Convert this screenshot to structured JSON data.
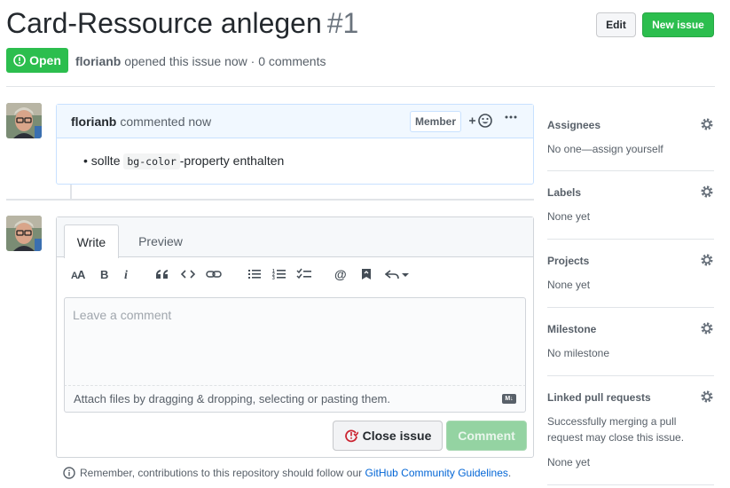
{
  "issue": {
    "title": "Card-Ressource anlegen",
    "number": "#1",
    "state": "Open",
    "author": "florianb",
    "meta_rest": "opened this issue now · 0 comments",
    "edit_label": "Edit",
    "new_issue_label": "New issue"
  },
  "comment": {
    "author": "florianb",
    "time": "commented now",
    "badge": "Member",
    "body_pre": "sollte",
    "body_code": "bg-color",
    "body_post": "-property enthalten"
  },
  "composer": {
    "tab_write": "Write",
    "tab_preview": "Preview",
    "placeholder": "Leave a comment",
    "attach_text": "Attach files by dragging & dropping, selecting or pasting them.",
    "close_label": "Close issue",
    "comment_label": "Comment"
  },
  "remember": {
    "prefix": "Remember, contributions to this repository should follow our",
    "link": "GitHub Community Guidelines",
    "suffix": "."
  },
  "sidebar": {
    "assignees": {
      "title": "Assignees",
      "value": "No one—assign yourself"
    },
    "labels": {
      "title": "Labels",
      "value": "None yet"
    },
    "projects": {
      "title": "Projects",
      "value": "None yet"
    },
    "milestone": {
      "title": "Milestone",
      "value": "No milestone"
    },
    "linked": {
      "title": "Linked pull requests",
      "value": "Successfully merging a pull request may close this issue.",
      "value2": "None yet"
    }
  },
  "colors": {
    "accent_green": "#2cbe4e",
    "link_blue": "#0366d6",
    "close_red": "#cb2431"
  }
}
